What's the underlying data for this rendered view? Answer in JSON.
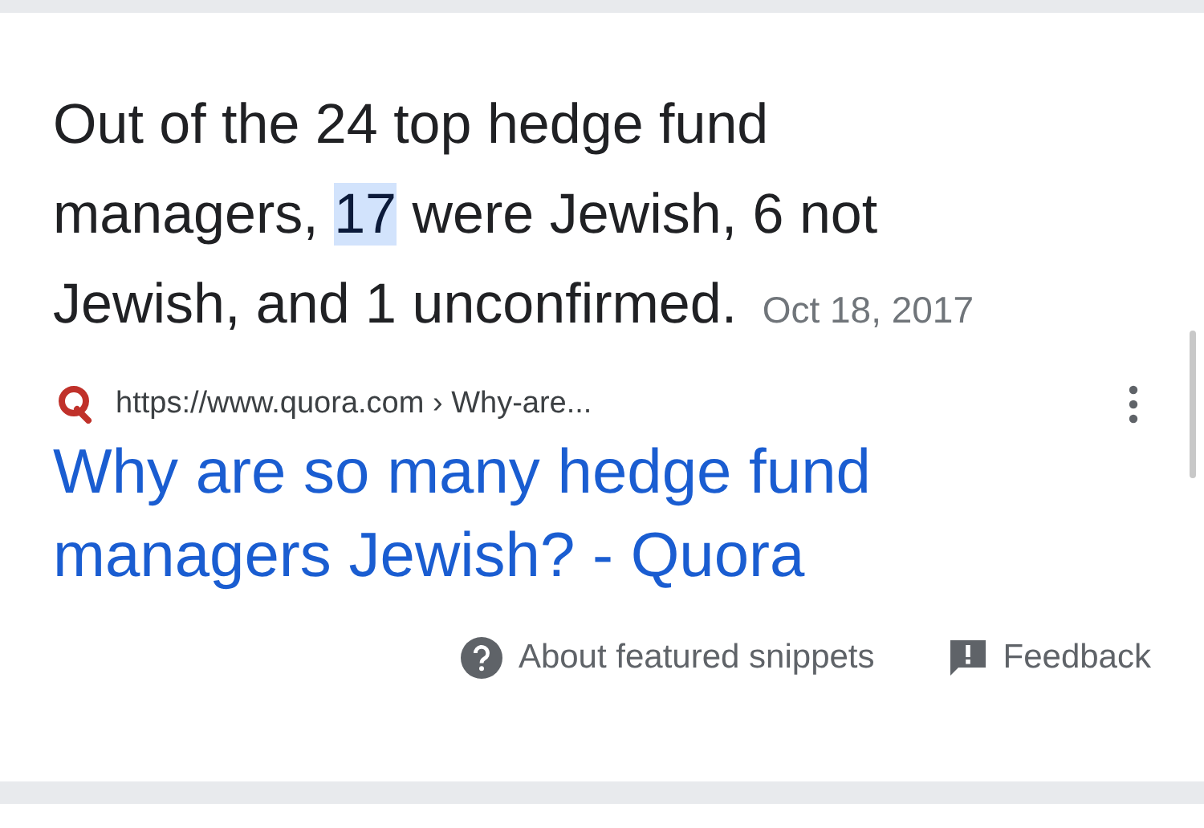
{
  "snippet": {
    "segments": [
      {
        "text": "Out of the 24 top hedge fund managers, ",
        "highlighted": false
      },
      {
        "text": "17",
        "highlighted": true
      },
      {
        "text": " were Jewish, 6 not Jewish, and 1 unconfirmed.",
        "highlighted": false
      }
    ],
    "date": "Oct 18, 2017"
  },
  "source": {
    "url": "https://www.quora.com › Why-are...",
    "title": "Why are so many hedge fund managers Jewish? - Quora"
  },
  "footer": {
    "about": "About featured snippets",
    "feedback": "Feedback"
  }
}
